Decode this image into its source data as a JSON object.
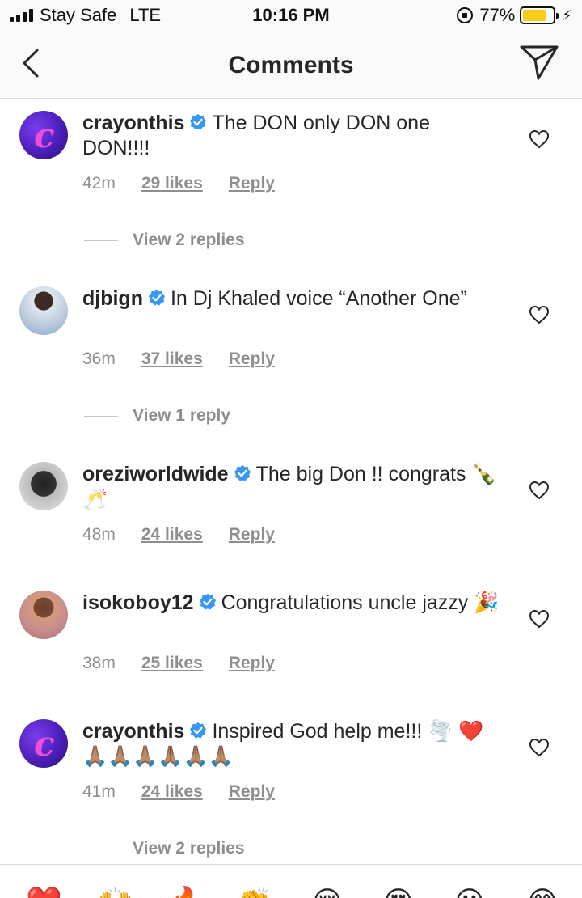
{
  "status_bar": {
    "carrier": "Stay Safe",
    "network": "LTE",
    "time": "10:16 PM",
    "battery_percent": "77%",
    "battery_level": 0.77,
    "battery_color": "#f7cc1a"
  },
  "header": {
    "title": "Comments",
    "back_icon": "chevron-left-icon",
    "send_icon": "paper-plane-icon"
  },
  "comments": [
    {
      "username": "crayonthis",
      "text": "The DON only DON one DON!!!!",
      "time": "42m",
      "likes": "29 likes",
      "reply": "Reply",
      "view_replies": "View 2 replies"
    },
    {
      "username": "djbign",
      "text": "In Dj Khaled voice “Another One”",
      "time": "36m",
      "likes": "37 likes",
      "reply": "Reply",
      "view_replies": "View 1 reply"
    },
    {
      "username": "oreziworldwide",
      "text": "The big Don !! congrats 🍾 🥂",
      "time": "48m",
      "likes": "24 likes",
      "reply": "Reply"
    },
    {
      "username": "isokoboy12",
      "text": "Congratulations uncle jazzy 🎉",
      "time": "38m",
      "likes": "25 likes",
      "reply": "Reply"
    },
    {
      "username": "crayonthis",
      "text": "Inspired God help me!!! 🌪️ ❤️🙏🏽🙏🏽🙏🏽🙏🏽🙏🏽🙏🏽",
      "time": "41m",
      "likes": "24 likes",
      "reply": "Reply",
      "view_replies": "View 2 replies"
    }
  ],
  "emoji_bar": [
    "❤️",
    "🙌",
    "🔥",
    "👏",
    "😢",
    "😍",
    "😮",
    "😂"
  ],
  "colors": {
    "verified": "#3897f0",
    "secondary_text": "#8e8e8e",
    "primary_text": "#262626"
  }
}
